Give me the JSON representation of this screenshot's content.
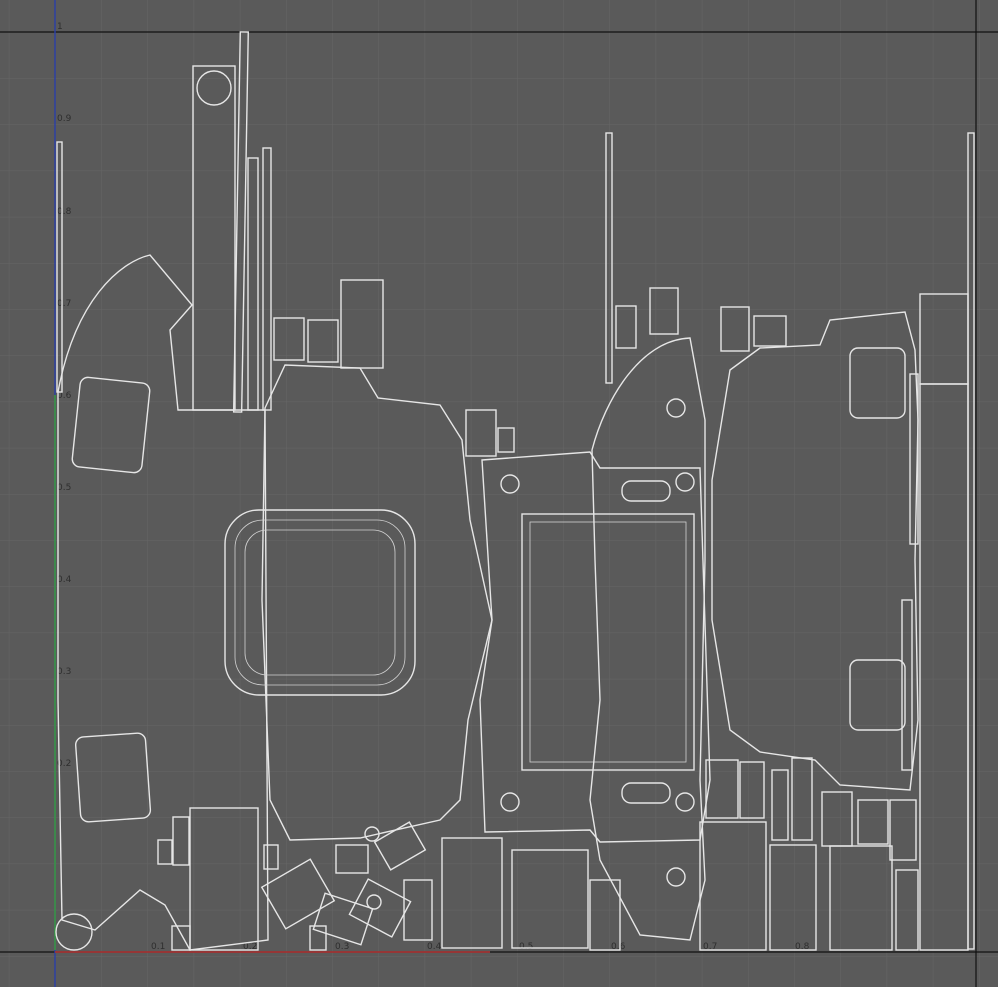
{
  "viewport": {
    "background": "#5a5a5a",
    "grid_color": "#666666",
    "border_color": "#111111",
    "wire_color": "#e6e6e6",
    "u_axis_color": "#b03030",
    "v_axis_color": "#2a3fa8",
    "v_axis_segment_color": "#3aa03a"
  },
  "v_ticks": [
    "1",
    "0.9",
    "0.8",
    "0.7",
    "0.6",
    "0.5",
    "0.4",
    "0.3",
    "0.2"
  ],
  "u_ticks": [
    "0.1",
    "0.2",
    "0.3",
    "0.4",
    "0.5",
    "0.6",
    "0.7",
    "0.8"
  ]
}
